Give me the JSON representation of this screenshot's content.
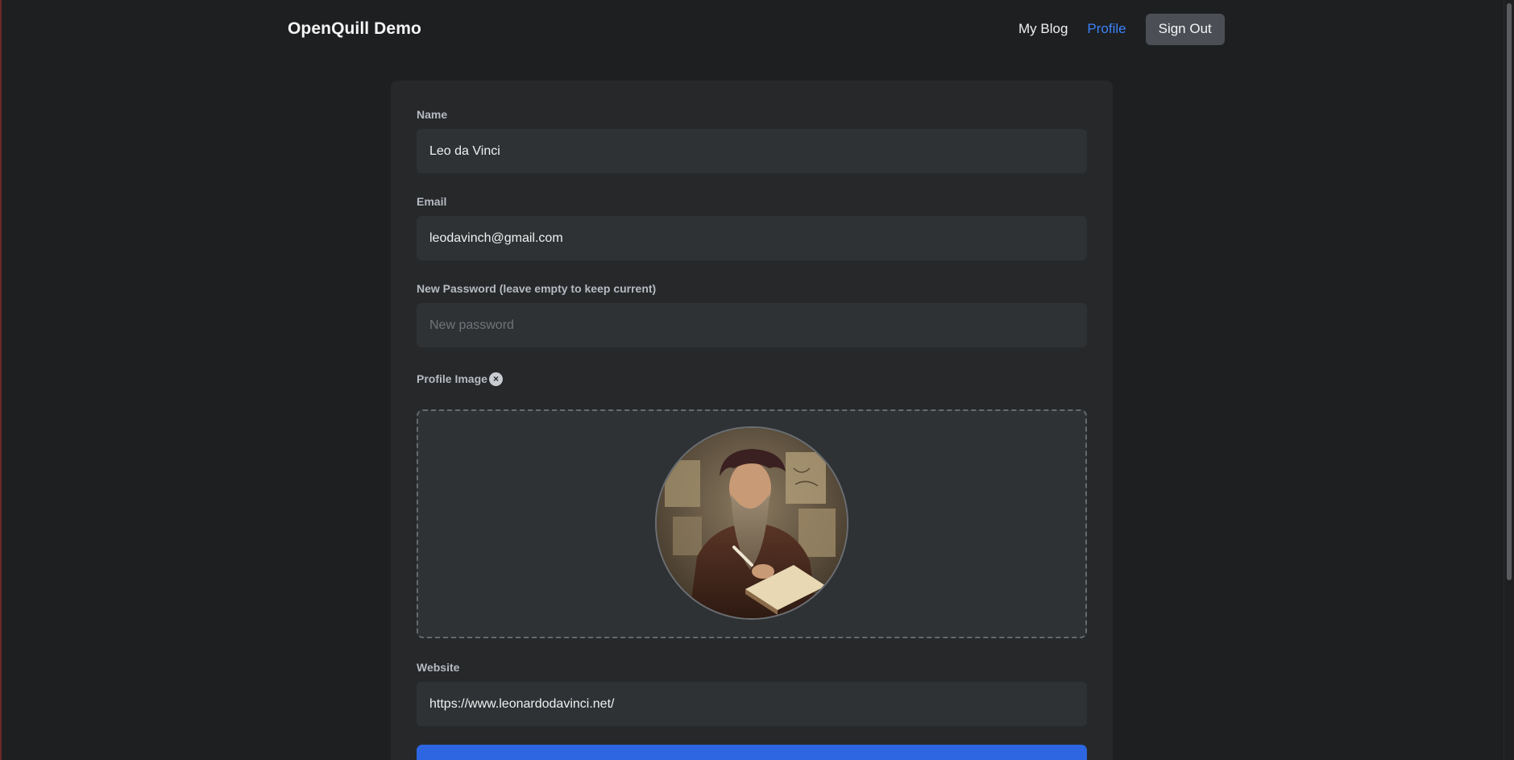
{
  "header": {
    "brand": "OpenQuill Demo",
    "nav": {
      "my_blog": "My Blog",
      "profile": "Profile",
      "sign_out": "Sign Out"
    }
  },
  "form": {
    "name": {
      "label": "Name",
      "value": "Leo da Vinci"
    },
    "email": {
      "label": "Email",
      "value": "leodavinch@gmail.com"
    },
    "password": {
      "label": "New Password (leave empty to keep current)",
      "value": "",
      "placeholder": "New password"
    },
    "profile_image": {
      "label": "Profile Image"
    },
    "website": {
      "label": "Website",
      "value": "https://www.leonardodavinci.net/"
    }
  },
  "colors": {
    "background": "#1e1f21",
    "card": "#26282a",
    "input": "#2f3234",
    "accent": "#3b82f6",
    "primary_button": "#2d66e0"
  }
}
